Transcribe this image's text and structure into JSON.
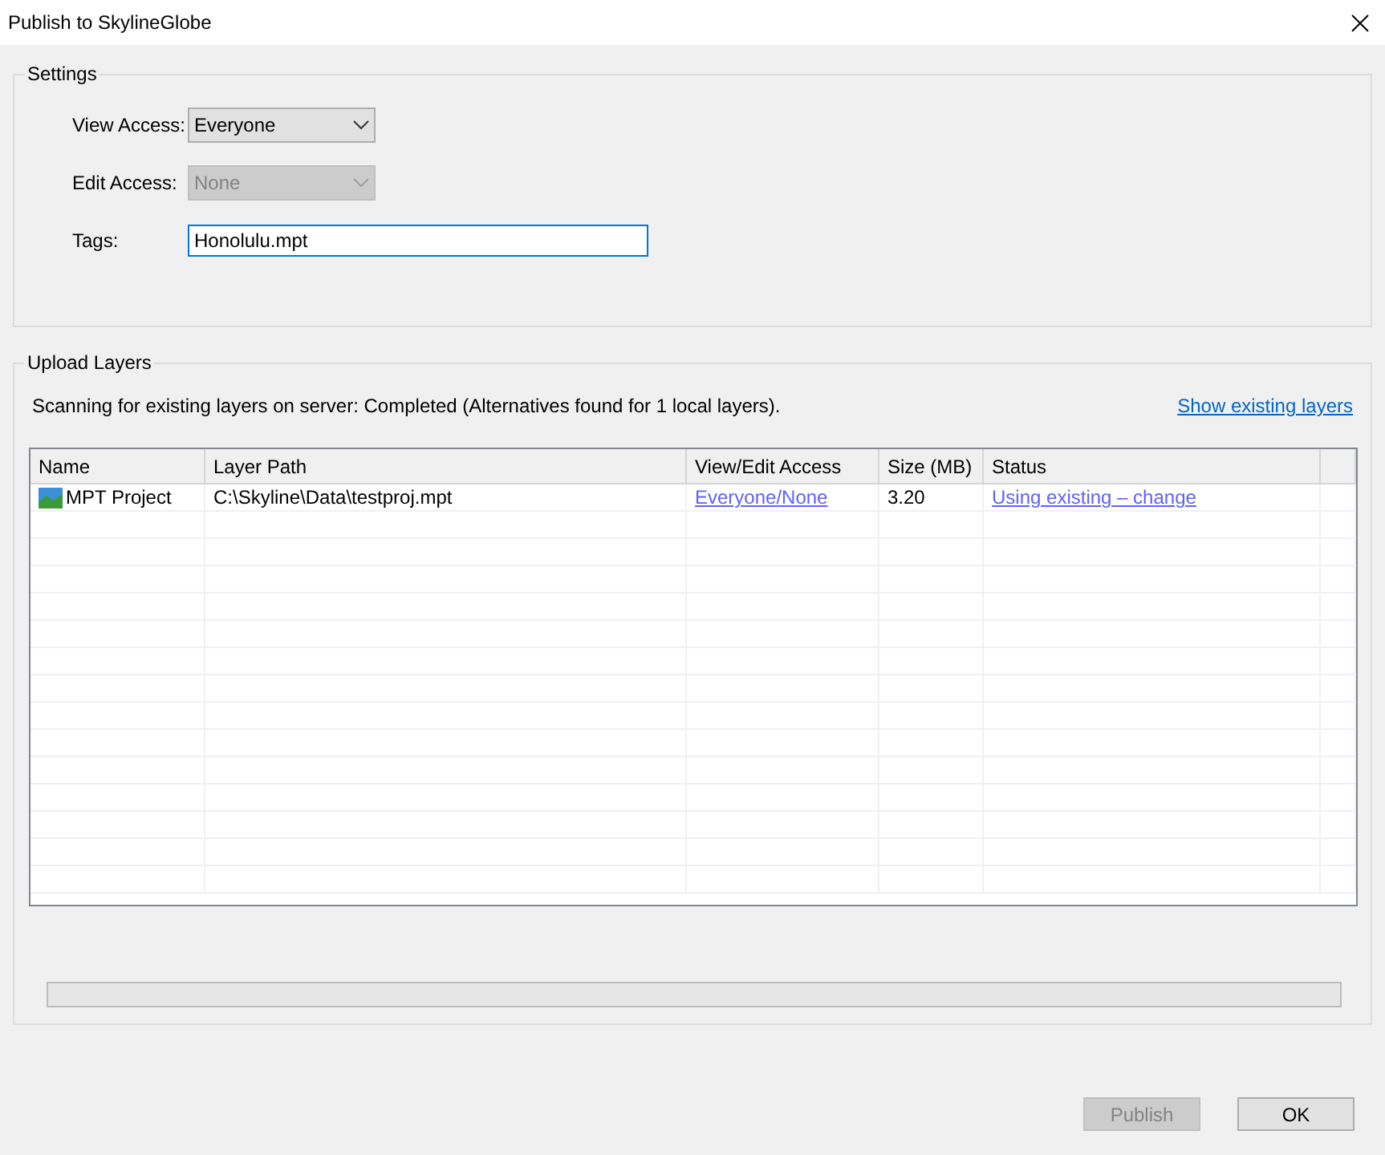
{
  "window": {
    "title": "Publish to SkylineGlobe"
  },
  "settings": {
    "title": "Settings",
    "fields": [
      {
        "kind": "dropdown",
        "label": "View Access:",
        "value": "Everyone",
        "disabled": false
      },
      {
        "kind": "dropdown",
        "label": "Edit Access:",
        "value": "None",
        "disabled": true
      },
      {
        "kind": "text",
        "label": "Tags:",
        "value": "Honolulu.mpt",
        "focused": true
      }
    ]
  },
  "upload_layers": {
    "title": "Upload Layers",
    "status_text": "Scanning for existing layers on server: Completed (Alternatives found for 1 local layers).",
    "show_existing_link": "Show existing layers",
    "table": {
      "columns": [
        "Name",
        "Layer Path",
        "View/Edit Access",
        "Size (MB)",
        "Status"
      ],
      "rows": [
        {
          "name": "MPT Project",
          "layer_path": "C:\\Skyline\\Data\\testproj.mpt",
          "access": "Everyone/None",
          "size": "3.20",
          "status": "Using existing – change"
        }
      ]
    },
    "progress": {
      "level": 0
    }
  },
  "buttons": [
    {
      "label": "Publish",
      "disabled": true
    },
    {
      "label": "OK",
      "disabled": false
    }
  ]
}
